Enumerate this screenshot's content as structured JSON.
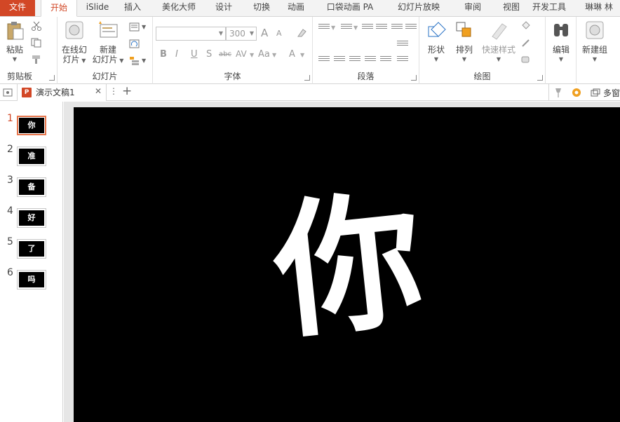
{
  "tabs": [
    {
      "label": "文件",
      "kind": "file"
    },
    {
      "label": "开始",
      "kind": "active"
    },
    {
      "label": "iSlide"
    },
    {
      "label": "插入"
    },
    {
      "label": "美化大师"
    },
    {
      "label": "设计"
    },
    {
      "label": "切换"
    },
    {
      "label": "动画"
    },
    {
      "label": "口袋动画 PA"
    },
    {
      "label": "幻灯片放映"
    },
    {
      "label": "审阅"
    },
    {
      "label": "视图"
    },
    {
      "label": "开发工具"
    },
    {
      "label": "琳琳 林"
    }
  ],
  "ribbon": {
    "clipboard": {
      "paste_label": "粘贴",
      "group_label": "剪贴板"
    },
    "slides": {
      "online_label_1": "在线幻",
      "online_label_2": "灯片",
      "new_label_1": "新建",
      "new_label_2": "幻灯片",
      "group_label": "幻灯片"
    },
    "font": {
      "font_name": "",
      "font_size": "300",
      "group_label": "字体",
      "bold": "B",
      "italic": "I",
      "underline": "U",
      "shadow": "S",
      "strike": "abc",
      "spacing": "AV",
      "case": "Aa",
      "color": "A",
      "grow": "A",
      "shrink": "A"
    },
    "paragraph": {
      "group_label": "段落"
    },
    "drawing": {
      "shape_label": "形状",
      "arrange_label": "排列",
      "quickstyle_label": "快速样式",
      "group_label": "绘图"
    },
    "editing": {
      "edit_label": "编辑"
    },
    "newgroup": {
      "label": "新建组"
    }
  },
  "document": {
    "tab_title": "演示文稿1",
    "multi_window_label": "多窗"
  },
  "slides": [
    {
      "number": "1",
      "text": "你",
      "selected": true
    },
    {
      "number": "2",
      "text": "准"
    },
    {
      "number": "3",
      "text": "备"
    },
    {
      "number": "4",
      "text": "好"
    },
    {
      "number": "5",
      "text": "了"
    },
    {
      "number": "6",
      "text": "吗"
    }
  ],
  "current_slide": {
    "text": "你"
  },
  "colors": {
    "accent": "#d24726",
    "slide_bg": "#000000",
    "slide_text": "#ffffff"
  }
}
